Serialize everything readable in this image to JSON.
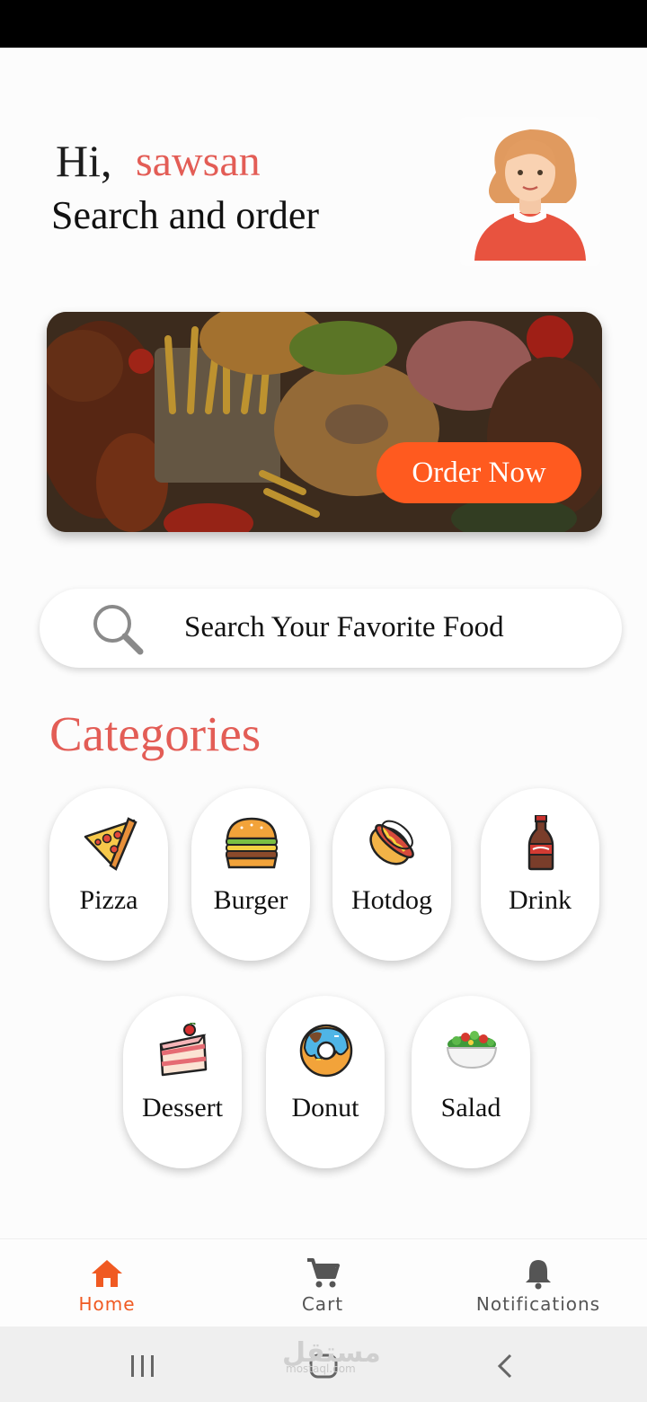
{
  "greeting": {
    "hi": "Hi,",
    "name": "sawsan",
    "subtitle": "Search and order"
  },
  "banner": {
    "button_label": "Order Now"
  },
  "search": {
    "placeholder": "Search Your Favorite Food"
  },
  "categories": {
    "title": "Categories",
    "items": [
      {
        "label": "Pizza",
        "icon": "pizza-icon"
      },
      {
        "label": "Burger",
        "icon": "burger-icon"
      },
      {
        "label": "Hotdog",
        "icon": "hotdog-icon"
      },
      {
        "label": "Drink",
        "icon": "drink-icon"
      },
      {
        "label": "Dessert",
        "icon": "cake-icon"
      },
      {
        "label": "Donut",
        "icon": "donut-icon"
      },
      {
        "label": "Salad",
        "icon": "salad-icon"
      }
    ]
  },
  "bottom_nav": {
    "items": [
      {
        "label": "Home",
        "icon": "home-icon",
        "active": true
      },
      {
        "label": "Cart",
        "icon": "cart-icon",
        "active": false
      },
      {
        "label": "Notifications",
        "icon": "bell-icon",
        "active": false
      }
    ]
  },
  "watermark": {
    "arabic": "مستقل",
    "latin": "mostaql.com"
  },
  "colors": {
    "accent": "#e35d56",
    "button": "#ff5a1f",
    "nav_active": "#f05a22",
    "nav_inactive": "#555555"
  }
}
